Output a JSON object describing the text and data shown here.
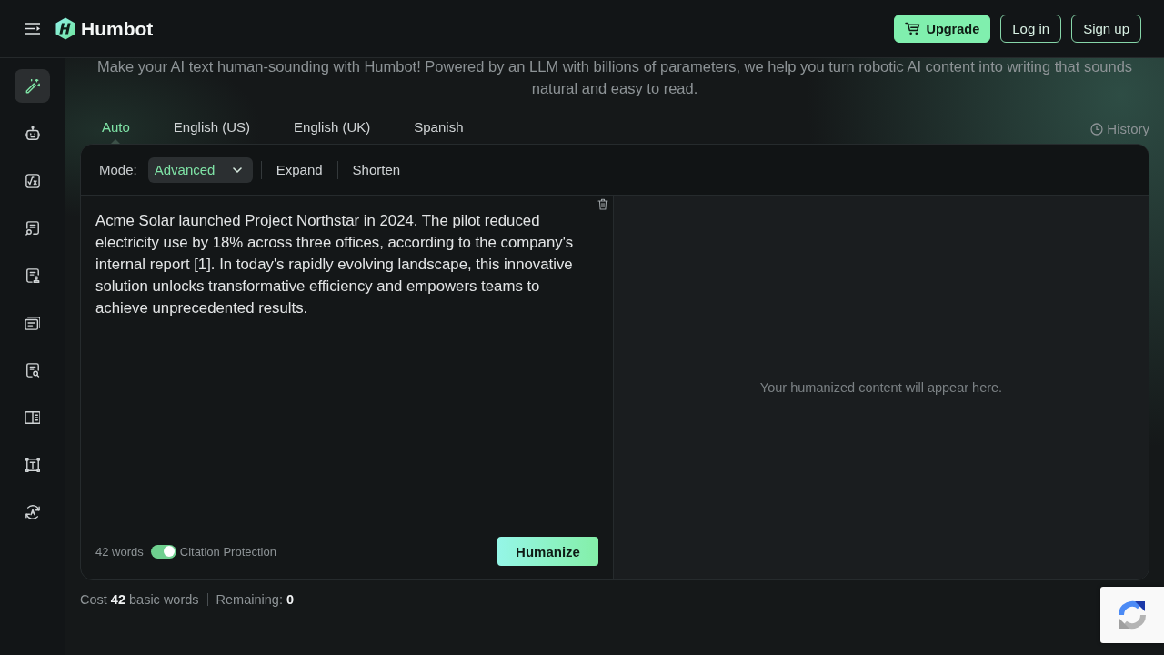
{
  "top_bar": {
    "brand": "Humbot",
    "buttons": [
      {
        "label": "Upgrade",
        "kind": "primary"
      },
      {
        "label": "Log in",
        "kind": "outline"
      },
      {
        "label": "Sign up",
        "kind": "outline"
      }
    ]
  },
  "sidebar": {
    "items": [
      {
        "selected": true
      },
      {
        "selected": false
      },
      {
        "selected": false
      },
      {
        "selected": false
      },
      {
        "selected": false
      },
      {
        "selected": false
      },
      {
        "selected": false
      },
      {
        "selected": false
      },
      {
        "selected": false
      },
      {
        "selected": false
      }
    ]
  },
  "intro": "Make your AI text human-sounding with Humbot! Powered by an LLM with billions of parameters, we help you turn robotic AI content into writing that sounds natural and easy to read.",
  "language_tabs": [
    {
      "label": "Auto",
      "selected": true
    },
    {
      "label": "English (US)",
      "selected": false
    },
    {
      "label": "English (UK)",
      "selected": false
    },
    {
      "label": "Spanish",
      "selected": false
    }
  ],
  "history_link": "History",
  "mode_bar": {
    "label": "Mode:",
    "options": [
      {
        "label": "Advanced",
        "kind": "dropdown",
        "selected": true
      },
      {
        "label": "Expand",
        "kind": "button",
        "selected": false
      },
      {
        "label": "Shorten",
        "kind": "button",
        "selected": false
      }
    ]
  },
  "input": {
    "value": "Acme Solar launched Project Northstar in 2024. The pilot reduced electricity use by 18% across three offices, according to the company's internal report [1]. In today's rapidly evolving landscape, this innovative solution unlocks transformative efficiency and empowers teams to achieve unprecedented results.",
    "word_count": "42 words",
    "citation_protection": {
      "label": "Citation Protection",
      "on": true
    },
    "submit": "Humanize"
  },
  "output": {
    "empty_message": "Your humanized content will appear here."
  },
  "footer": {
    "cost": "Cost **42** basic words",
    "remaining": "Remaining: **0**"
  }
}
